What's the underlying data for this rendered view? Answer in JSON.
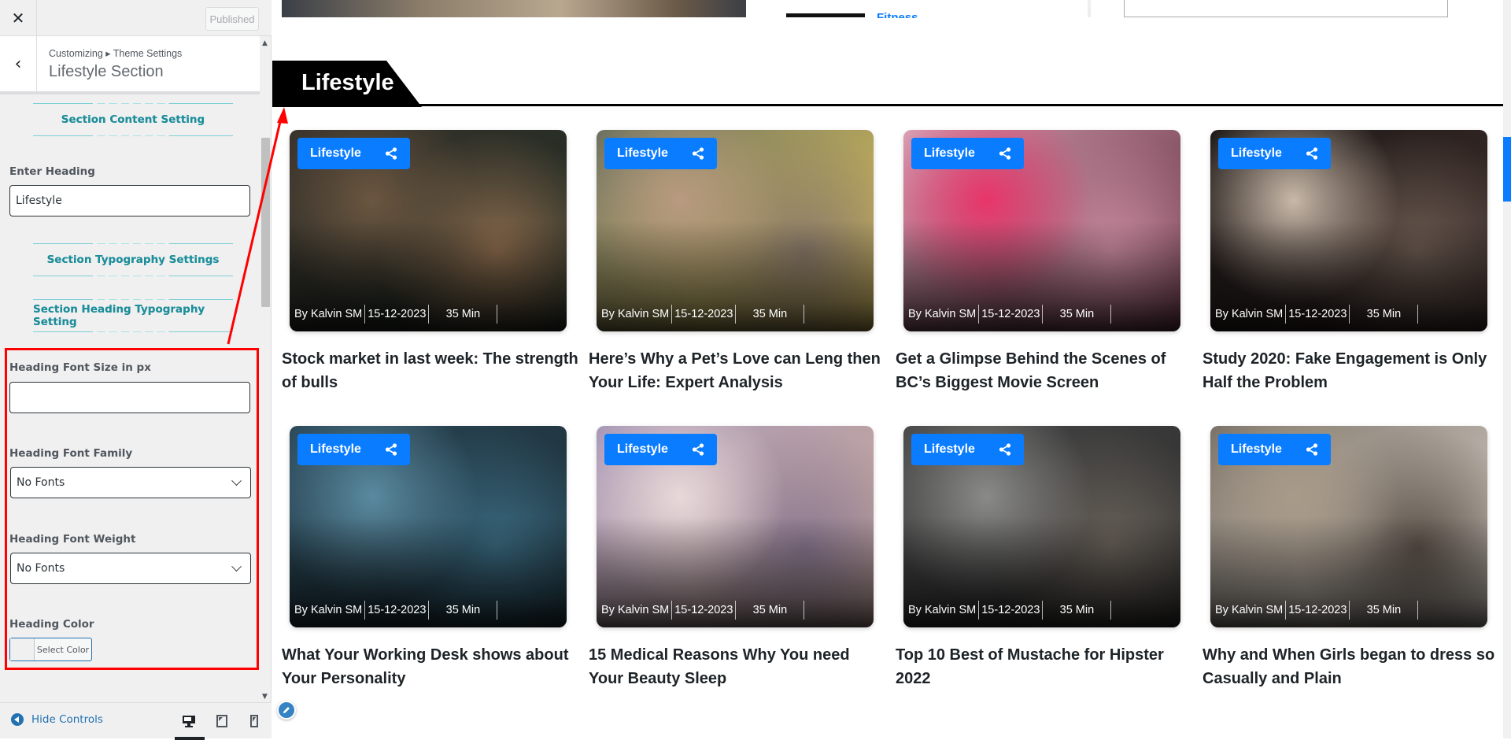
{
  "customizer": {
    "close_icon": "close-icon",
    "published_label": "Published",
    "breadcrumb": "Customizing ▸ Theme Settings",
    "panel_title": "Lifestyle Section",
    "sections": {
      "content_setting": "Section Content Setting",
      "typography_settings": "Section Typography Settings",
      "heading_typography_setting": "Section Heading Typography Setting"
    },
    "fields": {
      "enter_heading": {
        "label": "Enter Heading",
        "value": "Lifestyle"
      },
      "heading_font_size": {
        "label": "Heading Font Size in px",
        "value": ""
      },
      "heading_font_family": {
        "label": "Heading Font Family",
        "selected": "No Fonts"
      },
      "heading_font_weight": {
        "label": "Heading Font Weight",
        "selected": "No Fonts"
      },
      "heading_color": {
        "label": "Heading Color",
        "button_label": "Select Color"
      }
    },
    "footer": {
      "hide_controls_label": "Hide Controls",
      "devices": [
        "desktop",
        "tablet",
        "mobile"
      ],
      "active_device": "desktop"
    }
  },
  "preview": {
    "top_partial_link": "Fitness",
    "section_heading": "Lifestyle",
    "accent_color": "#0a7cff",
    "cards": [
      {
        "category": "Lifestyle",
        "author": "By Kalvin SM",
        "date": "15-12-2023",
        "read_time": "35 Min",
        "title": "Stock market in last week: The strength of bulls",
        "image_tones": [
          "#3a332c",
          "#6b5640",
          "#1c2a22",
          "#8a6a4c"
        ]
      },
      {
        "category": "Lifestyle",
        "author": "By Kalvin SM",
        "date": "15-12-2023",
        "read_time": "35 Min",
        "title": "Here’s Why a Pet’s Love can Leng then Your Life: Expert Analysis",
        "image_tones": [
          "#6b7060",
          "#b89a80",
          "#e0c45a",
          "#8a7a6a"
        ]
      },
      {
        "category": "Lifestyle",
        "author": "By Kalvin SM",
        "date": "15-12-2023",
        "read_time": "35 Min",
        "title": "Get a Glimpse Behind the Scenes of BC’s Biggest Movie Screen",
        "image_tones": [
          "#d9a0b4",
          "#e8356a",
          "#5a2a3a",
          "#c98aa0"
        ]
      },
      {
        "category": "Lifestyle",
        "author": "By Kalvin SM",
        "date": "15-12-2023",
        "read_time": "35 Min",
        "title": "Study 2020: Fake Engagement is Only Half the Problem",
        "image_tones": [
          "#1e1a18",
          "#c8b8a8",
          "#3a2a28",
          "#6a5a50"
        ]
      },
      {
        "category": "Lifestyle",
        "author": "By Kalvin SM",
        "date": "15-12-2023",
        "read_time": "35 Min",
        "title": "What Your Working Desk shows about Your Personality",
        "image_tones": [
          "#2c4a5a",
          "#5a8aa0",
          "#1a2a32",
          "#3a6a80"
        ]
      },
      {
        "category": "Lifestyle",
        "author": "By Kalvin SM",
        "date": "15-12-2023",
        "read_time": "35 Min",
        "title": "15 Medical Reasons Why You need Your Beauty Sleep",
        "image_tones": [
          "#a898b8",
          "#e8d8d8",
          "#c8a898",
          "#8a7890"
        ]
      },
      {
        "category": "Lifestyle",
        "author": "By Kalvin SM",
        "date": "15-12-2023",
        "read_time": "35 Min",
        "title": "Top 10 Best of Mustache for Hipster 2022",
        "image_tones": [
          "#4a4a4a",
          "#8a8a88",
          "#2a2a2a",
          "#6a625a"
        ]
      },
      {
        "category": "Lifestyle",
        "author": "By Kalvin SM",
        "date": "15-12-2023",
        "read_time": "35 Min",
        "title": "Why and When Girls began to dress so Casually and Plain",
        "image_tones": [
          "#7a7268",
          "#a89a88",
          "#d8d0c8",
          "#5a5048"
        ]
      }
    ]
  }
}
